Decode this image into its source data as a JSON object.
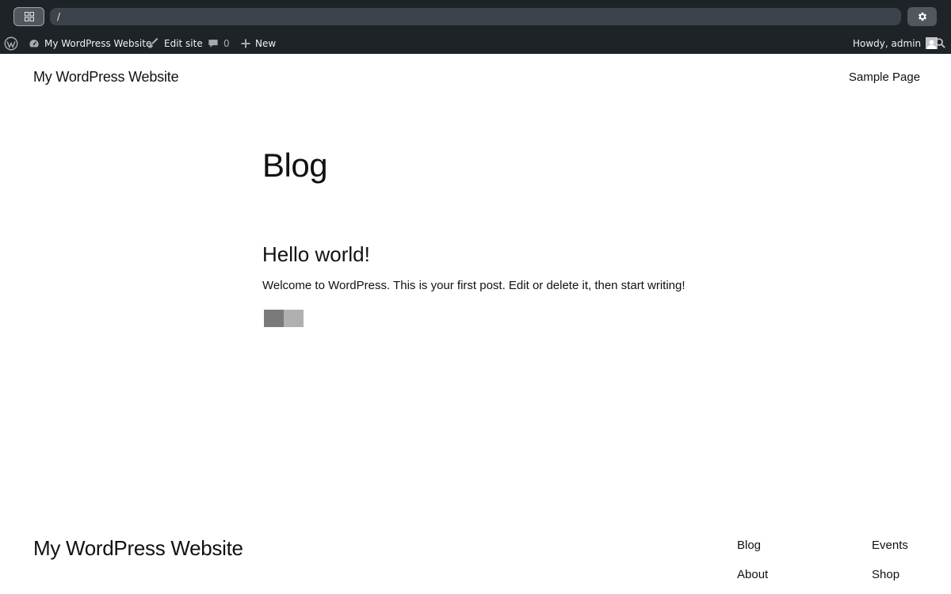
{
  "browser": {
    "url": "/"
  },
  "admin_bar": {
    "site_name": "My WordPress Website",
    "edit_site": "Edit site",
    "comments_count": "0",
    "new_label": "New",
    "howdy": "Howdy, admin"
  },
  "header": {
    "site_title": "My WordPress Website",
    "nav": [
      "Sample Page"
    ]
  },
  "main": {
    "page_title": "Blog",
    "posts": [
      {
        "title": "Hello world!",
        "excerpt": "Welcome to WordPress. This is your first post. Edit or delete it, then start writing!"
      }
    ]
  },
  "footer": {
    "site_title": "My WordPress Website",
    "links": [
      "Blog",
      "About",
      "Events",
      "Shop"
    ]
  },
  "colors": {
    "browser_bar": "#1e2327",
    "admin_bar": "#1d2327",
    "text": "#111111",
    "background": "#ffffff"
  }
}
